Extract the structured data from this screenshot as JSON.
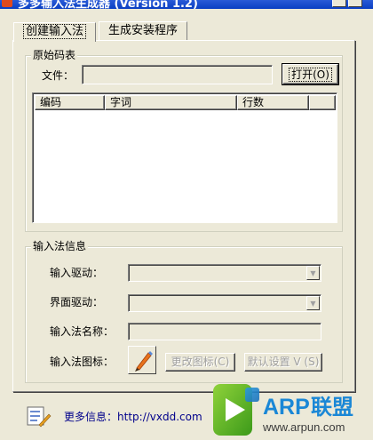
{
  "window": {
    "title": "多多输入法生成器 (Version 1.2)",
    "accent": "#0a3fc2",
    "background": "#ece9d8"
  },
  "tabs": [
    {
      "label": "创建输入法",
      "active": true
    },
    {
      "label": "生成安装程序",
      "active": false
    }
  ],
  "source_group": {
    "title": "原始码表",
    "file_label": "文件：",
    "file_value": "",
    "open_button": "打开(O)",
    "table": {
      "columns": [
        "编码",
        "字词",
        "行数"
      ],
      "rows": []
    }
  },
  "ime_group": {
    "title": "输入法信息",
    "input_driver_label": "输入驱动：",
    "input_driver_value": "",
    "ui_driver_label": "界面驱动：",
    "ui_driver_value": "",
    "name_label": "输入法名称：",
    "name_value": "",
    "icon_label": "输入法图标：",
    "icon_name": "pen-icon",
    "change_icon_button": "更改图标(C)",
    "default_settings_button": "默认设置 V (S)"
  },
  "footer": {
    "more_info_label": "更多信息：",
    "url": "http://vxdd.com",
    "icon_name": "tools-icon"
  },
  "watermark": {
    "brand": "ARP联盟",
    "url": "www.arpun.com"
  }
}
